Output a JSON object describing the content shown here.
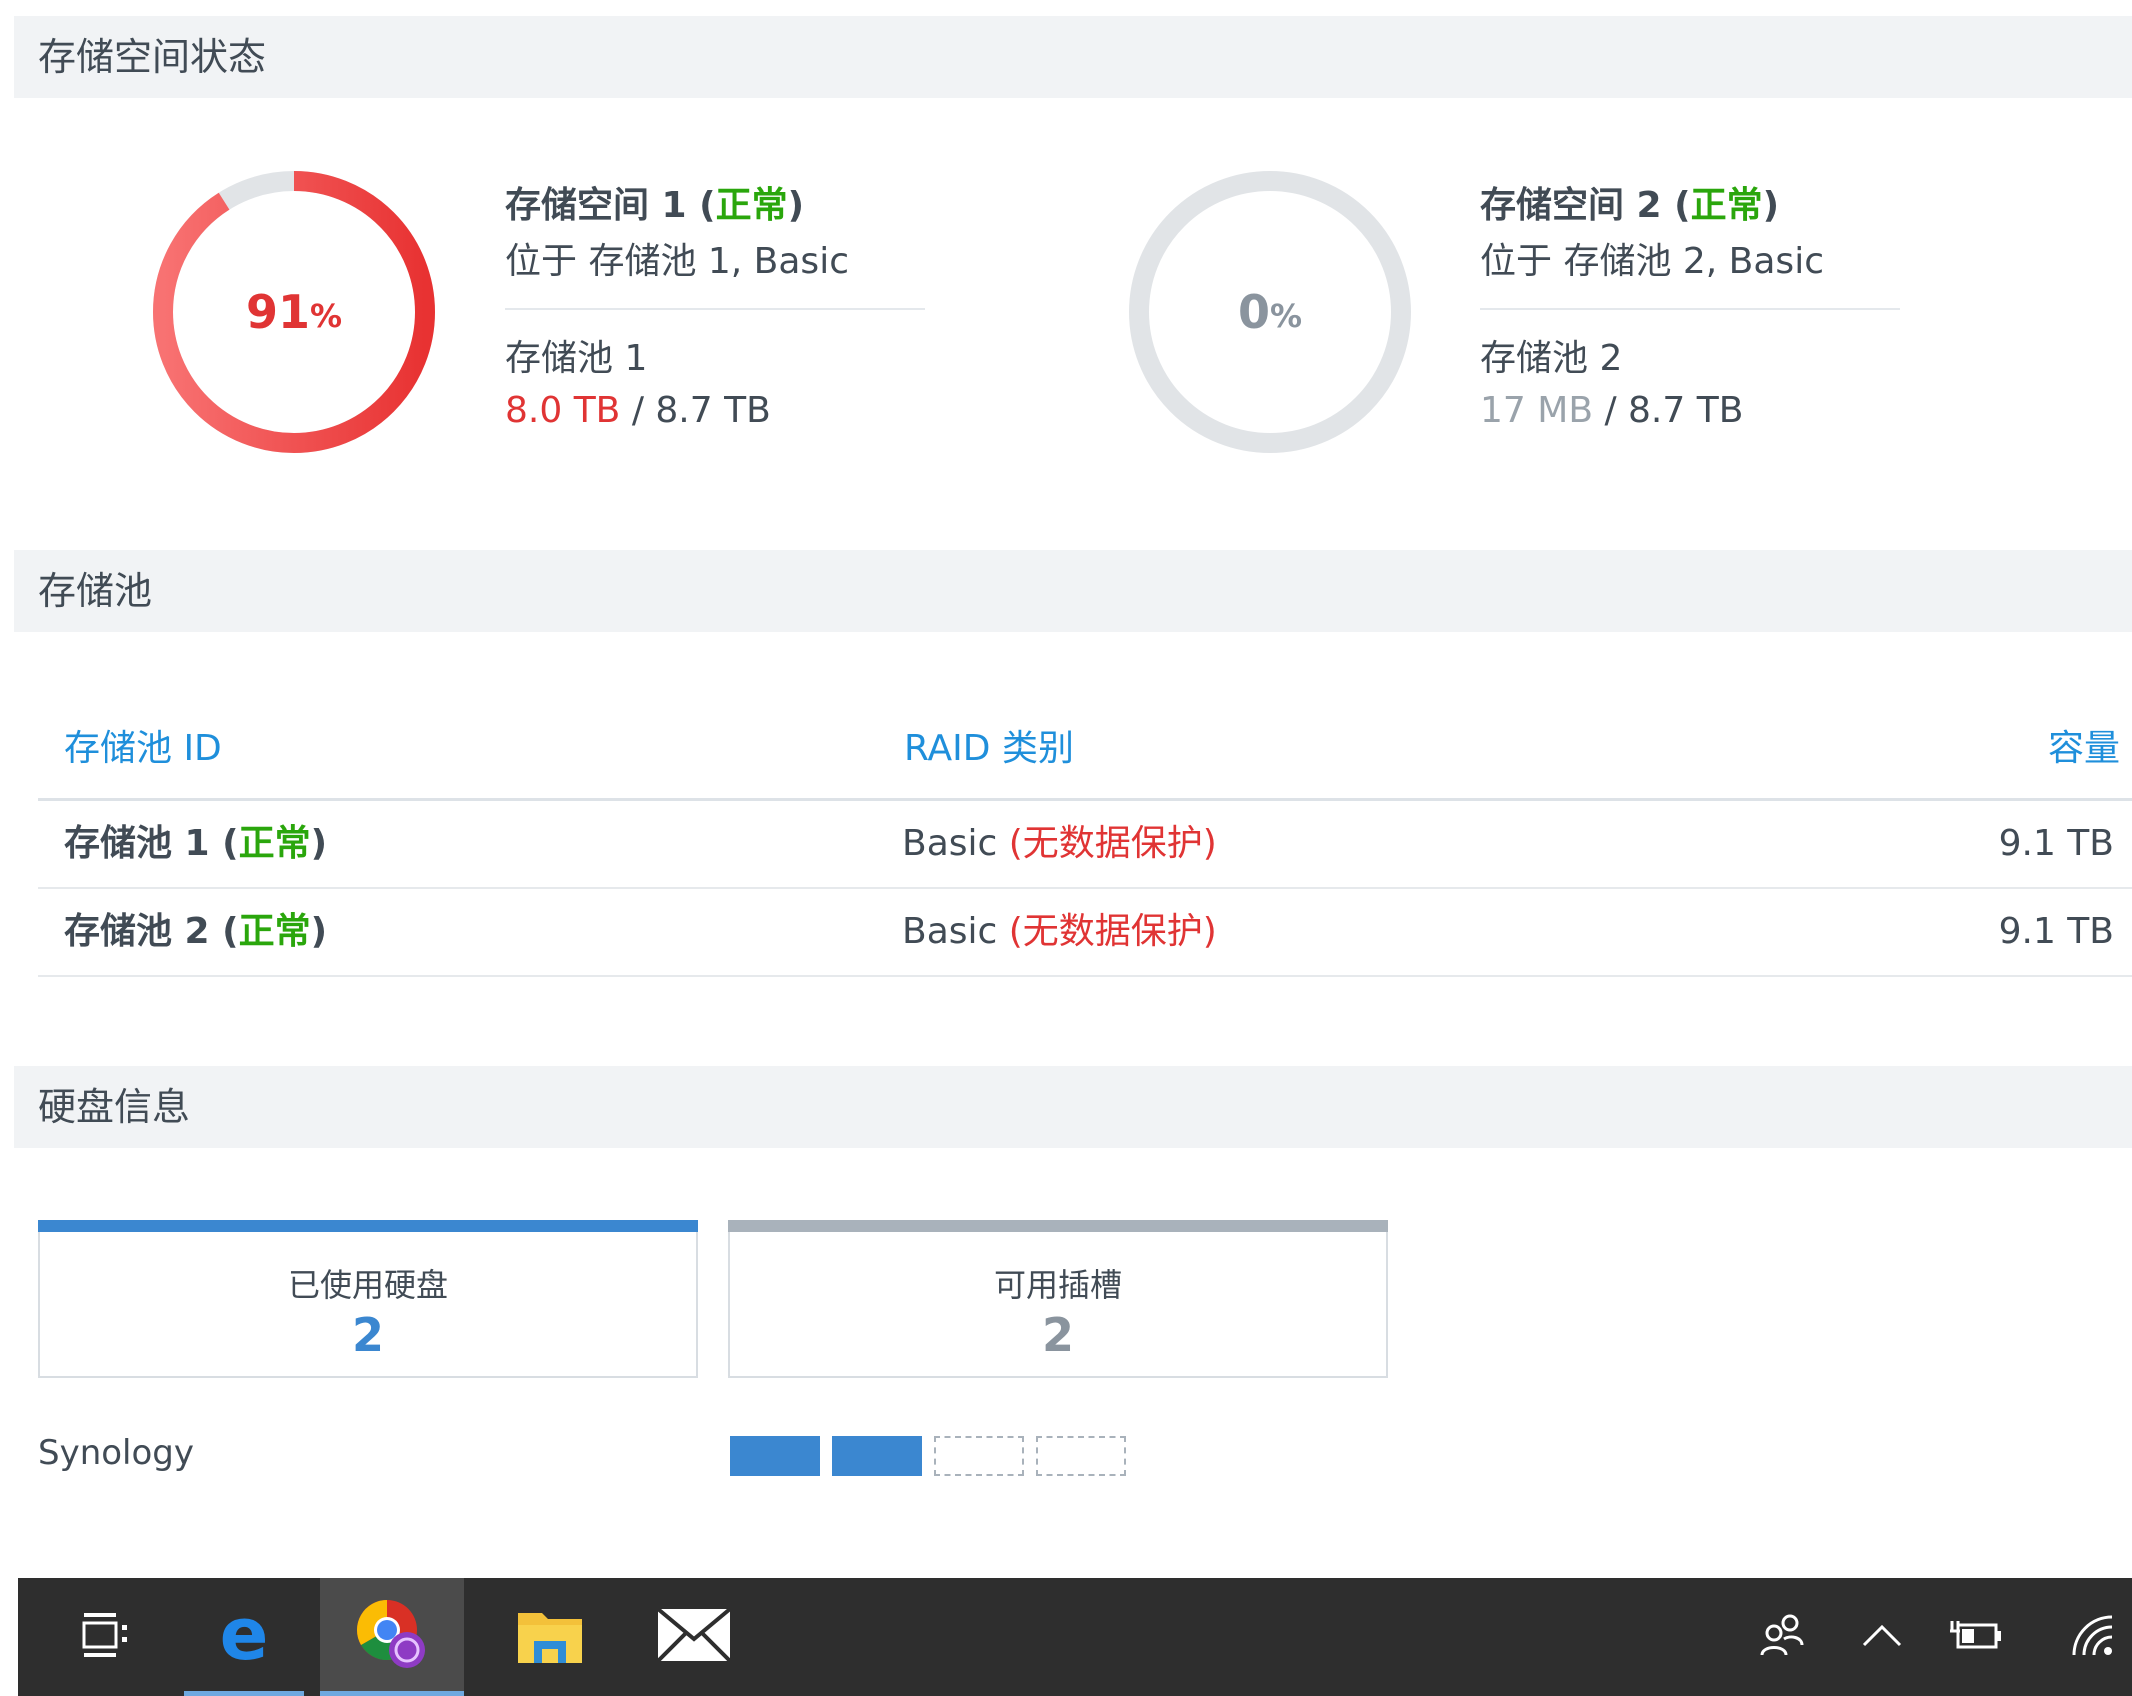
{
  "sections": {
    "storage_status": "存储空间状态",
    "storage_pool": "存储池",
    "disk_info": "硬盘信息"
  },
  "volumes": [
    {
      "usage_percent_value": 91,
      "usage_percent_num": "91",
      "usage_percent_sign": "%",
      "name": "存储空间 1",
      "status": "正常",
      "location": "位于 存储池 1, Basic",
      "pool": "存储池 1",
      "used": "8.0 TB",
      "total": "8.7 TB",
      "ring_color": "#ee3f3f"
    },
    {
      "usage_percent_value": 0,
      "usage_percent_num": "0",
      "usage_percent_sign": "%",
      "name": "存储空间 2",
      "status": "正常",
      "location": "位于 存储池 2, Basic",
      "pool": "存储池 2",
      "used": "17 MB",
      "total": "8.7 TB",
      "ring_color": "#e1e4e7"
    }
  ],
  "pool_table": {
    "headers": {
      "id": "存储池 ID",
      "raid": "RAID 类别",
      "capacity": "容量"
    },
    "rows": [
      {
        "name": "存储池 1",
        "status": "正常",
        "raid": "Basic",
        "raid_note": "(无数据保护)",
        "capacity": "9.1 TB"
      },
      {
        "name": "存储池 2",
        "status": "正常",
        "raid": "Basic",
        "raid_note": "(无数据保护)",
        "capacity": "9.1 TB"
      }
    ]
  },
  "disk_info": {
    "used_label": "已使用硬盘",
    "used_value": "2",
    "available_label": "可用插槽",
    "available_value": "2",
    "brand": "Synology",
    "slots": [
      "used",
      "used",
      "empty",
      "empty"
    ]
  },
  "taskbar": {
    "apps": [
      "task-view-icon",
      "edge-icon",
      "chrome-icon",
      "file-explorer-icon",
      "mail-icon"
    ],
    "tray": [
      "people-icon",
      "chevron-up-icon",
      "battery-icon",
      "wifi-icon"
    ]
  },
  "colors": {
    "link_blue": "#1f8fdb",
    "status_green": "#2aa60c",
    "warning_red": "#e03434",
    "slot_blue": "#3b87d0"
  }
}
